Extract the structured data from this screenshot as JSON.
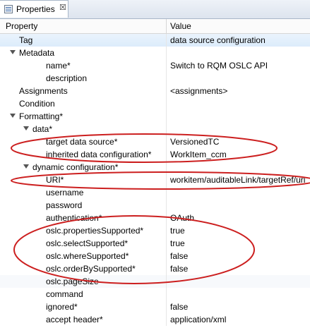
{
  "tab": {
    "label": "Properties",
    "close_glyph": "☒"
  },
  "header": {
    "col_property": "Property",
    "col_value": "Value"
  },
  "rows": [
    {
      "key": "Tag",
      "value": "data source configuration",
      "indent": 0,
      "arrow": "",
      "selected": true
    },
    {
      "key": "Metadata",
      "value": "",
      "indent": 0,
      "arrow": "down"
    },
    {
      "key": "name*",
      "value": "Switch to RQM OSLC API",
      "indent": 2,
      "arrow": ""
    },
    {
      "key": "description",
      "value": "",
      "indent": 2,
      "arrow": ""
    },
    {
      "key": "Assignments",
      "value": "<assignments>",
      "indent": 0,
      "arrow": ""
    },
    {
      "key": "Condition",
      "value": "",
      "indent": 0,
      "arrow": ""
    },
    {
      "key": "Formatting*",
      "value": "",
      "indent": 0,
      "arrow": "down"
    },
    {
      "key": "data*",
      "value": "",
      "indent": 1,
      "arrow": "down"
    },
    {
      "key": "target data source*",
      "value": "VersionedTC",
      "indent": 2,
      "arrow": ""
    },
    {
      "key": "inherited data configuration*",
      "value": "WorkItem_ccm",
      "indent": 2,
      "arrow": ""
    },
    {
      "key": "dynamic configuration*",
      "value": "",
      "indent": 1,
      "arrow": "down"
    },
    {
      "key": "URI*",
      "value": "workitem/auditableLink/targetRef/uri",
      "indent": 2,
      "arrow": ""
    },
    {
      "key": "username",
      "value": "",
      "indent": 2,
      "arrow": ""
    },
    {
      "key": "password",
      "value": "",
      "indent": 2,
      "arrow": ""
    },
    {
      "key": "authentication*",
      "value": "OAuth",
      "indent": 2,
      "arrow": ""
    },
    {
      "key": "oslc.propertiesSupported*",
      "value": "true",
      "indent": 2,
      "arrow": ""
    },
    {
      "key": "oslc.selectSupported*",
      "value": "true",
      "indent": 2,
      "arrow": ""
    },
    {
      "key": "oslc.whereSupported*",
      "value": "false",
      "indent": 2,
      "arrow": ""
    },
    {
      "key": "oslc.orderBySupported*",
      "value": "false",
      "indent": 2,
      "arrow": ""
    },
    {
      "key": "oslc.pageSize",
      "value": "",
      "indent": 2,
      "arrow": "",
      "highlight": true
    },
    {
      "key": "command",
      "value": "",
      "indent": 2,
      "arrow": ""
    },
    {
      "key": "ignored*",
      "value": "false",
      "indent": 2,
      "arrow": ""
    },
    {
      "key": "accept header*",
      "value": "application/xml",
      "indent": 2,
      "arrow": ""
    }
  ],
  "colors": {
    "annotation_ellipse": "#cc1f1f",
    "selection": "#dcecfb"
  }
}
